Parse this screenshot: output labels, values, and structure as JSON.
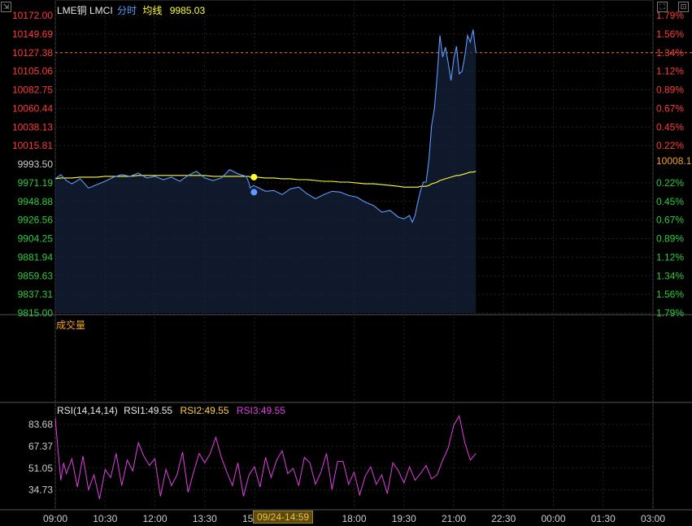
{
  "header": {
    "symbol": "LME铜 LMCI",
    "mode": "分时",
    "avg_label": "均线",
    "avg_value": "9985.03"
  },
  "price_panel": {
    "last_price_tag": "10008.1",
    "colors": {
      "up": "#ff3a3a",
      "down": "#2ecc40",
      "neutral": "#cccccc",
      "line": "#5b9cff",
      "avg": "#ffff33"
    }
  },
  "volume_panel": {
    "title": "成交量"
  },
  "rsi_panel": {
    "title": "RSI(14,14,14)",
    "rsi1_label": "RSI1:49.55",
    "rsi2_label": "RSI2:49.55",
    "rsi3_label": "RSI3:49.55"
  },
  "crosshair": {
    "time_label": "09/24-14:59"
  },
  "chart_data": [
    {
      "type": "line",
      "name": "price",
      "y_ticks": [
        "10172.00",
        "10149.69",
        "10127.38",
        "10105.06",
        "10082.75",
        "10060.44",
        "10038.13",
        "10015.81",
        "9993.50",
        "9971.19",
        "9948.88",
        "9926.56",
        "9904.25",
        "9881.94",
        "9859.63",
        "9837.31",
        "9815.00"
      ],
      "pct_ticks": [
        "1.79%",
        "1.56%",
        "1.34%",
        "1.12%",
        "0.89%",
        "0.67%",
        "0.45%",
        "0.22%",
        "",
        "0.22%",
        "0.45%",
        "0.67%",
        "0.89%",
        "1.12%",
        "1.34%",
        "1.56%",
        "1.79%"
      ],
      "ylim": [
        9815.0,
        10172.0
      ],
      "prev_close": 9993.5,
      "x_ticks": [
        "09:00",
        "10:30",
        "12:00",
        "13:30",
        "15:00",
        "18:00",
        "19:30",
        "21:00",
        "22:30",
        "00:00",
        "01:30",
        "03:00"
      ],
      "x_tick_minutes": [
        0,
        90,
        180,
        270,
        360,
        540,
        630,
        720,
        810,
        900,
        990,
        1080
      ],
      "x_minutes": [
        0,
        10,
        20,
        30,
        45,
        60,
        75,
        90,
        105,
        120,
        135,
        150,
        165,
        180,
        195,
        210,
        225,
        240,
        255,
        270,
        285,
        300,
        315,
        330,
        345,
        350,
        352,
        358,
        365,
        380,
        395,
        410,
        425,
        440,
        455,
        470,
        485,
        500,
        515,
        530,
        545,
        560,
        575,
        590,
        605,
        620,
        630,
        640,
        645,
        650,
        655,
        660,
        665,
        670,
        675,
        680,
        685,
        690,
        695,
        700,
        705,
        710,
        715,
        720,
        725,
        730,
        735,
        740,
        745,
        750,
        755,
        760
      ],
      "price": [
        9976,
        9981,
        9974,
        9970,
        9976,
        9965,
        9969,
        9973,
        9978,
        9981,
        9979,
        9983,
        9977,
        9979,
        9975,
        9978,
        9973,
        9980,
        9985,
        9977,
        9974,
        9977,
        9987,
        9982,
        9979,
        9971,
        9965,
        9968,
        9966,
        9961,
        9962,
        9957,
        9964,
        9966,
        9958,
        9952,
        9957,
        9961,
        9960,
        9956,
        9954,
        9948,
        9944,
        9936,
        9938,
        9930,
        9928,
        9932,
        9924,
        9932,
        9948,
        9962,
        9972,
        9972,
        9998,
        10040,
        10060,
        10100,
        10148,
        10122,
        10134,
        10115,
        10094,
        10120,
        10135,
        10102,
        10105,
        10123,
        10148,
        10140,
        10155,
        10128
      ],
      "avg": [
        9976,
        9977,
        9977,
        9977,
        9978,
        9978,
        9978,
        9979,
        9979,
        9979,
        9979,
        9980,
        9980,
        9980,
        9980,
        9980,
        9980,
        9980,
        9980,
        9980,
        9979,
        9979,
        9979,
        9979,
        9979,
        9979,
        9978,
        9978,
        9978,
        9977,
        9977,
        9976,
        9976,
        9975,
        9975,
        9974,
        9973,
        9973,
        9972,
        9972,
        9971,
        9970,
        9970,
        9969,
        9968,
        9967,
        9966,
        9966,
        9966,
        9966,
        9966,
        9967,
        9967,
        9967,
        9968,
        9970,
        9971,
        9972,
        9974,
        9975,
        9976,
        9977,
        9978,
        9979,
        9980,
        9980,
        9981,
        9982,
        9983,
        9984,
        9984,
        9985
      ],
      "last_price": 10127.38,
      "crosshair_minute": 359
    },
    {
      "type": "line",
      "name": "RSI",
      "y_ticks": [
        "83.68",
        "67.37",
        "51.05",
        "34.73"
      ],
      "ylim": [
        20,
        100
      ],
      "x_minutes": [
        0,
        5,
        10,
        15,
        20,
        30,
        40,
        50,
        60,
        70,
        80,
        90,
        100,
        110,
        120,
        130,
        140,
        150,
        160,
        170,
        180,
        190,
        200,
        210,
        220,
        230,
        240,
        250,
        260,
        270,
        280,
        290,
        300,
        310,
        320,
        330,
        340,
        350,
        360,
        370,
        380,
        390,
        400,
        410,
        420,
        430,
        440,
        450,
        460,
        470,
        480,
        490,
        500,
        510,
        520,
        530,
        540,
        550,
        560,
        570,
        580,
        590,
        600,
        610,
        620,
        630,
        640,
        650,
        660,
        670,
        680,
        690,
        700,
        710,
        720,
        730,
        740,
        750,
        760
      ],
      "values": [
        88,
        64,
        42,
        55,
        47,
        58,
        37,
        60,
        35,
        46,
        28,
        50,
        44,
        62,
        38,
        57,
        49,
        70,
        60,
        53,
        58,
        30,
        50,
        38,
        46,
        63,
        33,
        48,
        62,
        55,
        62,
        74,
        59,
        48,
        38,
        55,
        30,
        46,
        52,
        37,
        59,
        44,
        57,
        64,
        47,
        51,
        38,
        59,
        55,
        39,
        48,
        62,
        35,
        56,
        56,
        39,
        48,
        31,
        45,
        52,
        39,
        46,
        32,
        55,
        49,
        40,
        52,
        42,
        47,
        53,
        43,
        46,
        57,
        66,
        83,
        90,
        70,
        57,
        62
      ]
    }
  ]
}
